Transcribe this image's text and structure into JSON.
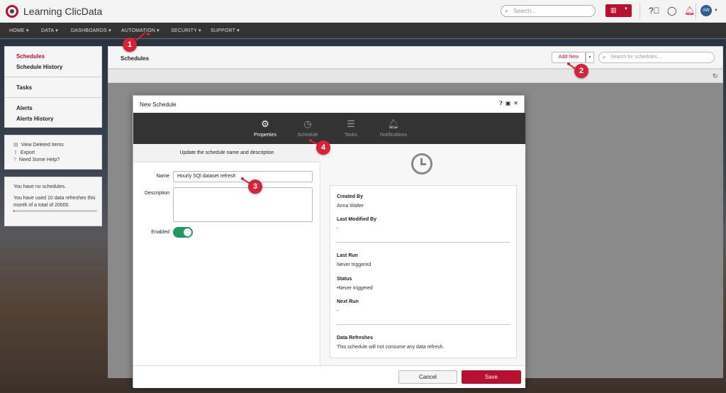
{
  "app": {
    "title": "Learning ClicData"
  },
  "topbar": {
    "search_placeholder": "Search...",
    "icons": [
      "search-icon",
      "chart-icon",
      "help-icon",
      "chat-icon",
      "bell-icon"
    ],
    "avatar_initials": "AW"
  },
  "nav": {
    "items": [
      {
        "label": "HOME ▾"
      },
      {
        "label": "DATA ▾"
      },
      {
        "label": "DASHBOARDS ▾"
      },
      {
        "label": "AUTOMATION ▾"
      },
      {
        "label": "SECURITY ▾"
      },
      {
        "label": "SUPPORT ▾"
      }
    ]
  },
  "sidebar": {
    "links": [
      {
        "label": "Schedules",
        "active": true
      },
      {
        "label": "Schedule History"
      },
      {
        "label": "Tasks"
      },
      {
        "label": "Alerts"
      },
      {
        "label": "Alerts History"
      }
    ],
    "actions": [
      {
        "label": "View Deleted Items"
      },
      {
        "label": "Export"
      },
      {
        "label": "Need Some Help?"
      }
    ],
    "info": {
      "no_schedules": "You have no schedules.",
      "usage": "You have used 10 data refreshes this month of a total of 20000.",
      "usage_fraction": 0.0005
    }
  },
  "main": {
    "title": "Schedules",
    "add_new": "Add New",
    "search_placeholder": "Search for schedules..."
  },
  "modal": {
    "title": "New Schedule",
    "tabs": [
      {
        "label": "Properties",
        "icon": "gear-icon",
        "active": true
      },
      {
        "label": "Schedule",
        "icon": "clock-icon"
      },
      {
        "label": "Tasks",
        "icon": "database-icon"
      },
      {
        "label": "Notifications",
        "icon": "bell-icon"
      }
    ],
    "section_heading": "Update the schedule name and description",
    "name_label": "Name",
    "name_value": "Hourly SQl dataset refresh",
    "description_label": "Description",
    "enabled_label": "Enabled",
    "enabled": true,
    "info": {
      "created_by_label": "Created By",
      "created_by": "Anna Walter",
      "last_modified_label": "Last Modified By",
      "last_modified": "-",
      "last_run_label": "Last Run",
      "last_run": "Never triggered",
      "status_label": "Status",
      "status": "Never triggered",
      "next_run_label": "Next Run",
      "next_run": "-",
      "refreshes_label": "Data Refreshes",
      "refreshes": "This schedule will not consume any data refresh."
    },
    "cancel": "Cancel",
    "save": "Save"
  },
  "callouts": [
    "1",
    "2",
    "3",
    "4"
  ],
  "colors": {
    "accent": "#b8102f",
    "toggle_on": "#1f9a5a",
    "nav_bg": "#333333",
    "callout": "#d4243a"
  }
}
